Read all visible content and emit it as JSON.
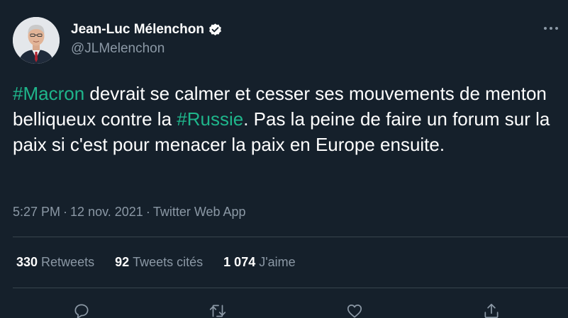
{
  "author": {
    "name": "Jean-Luc Mélenchon",
    "handle": "@JLMelenchon",
    "verified": true
  },
  "tweet": {
    "hashtag_1": "#Macron",
    "text_1": " devrait se calmer et cesser ses mouvements de menton belliqueux contre la ",
    "hashtag_2": "#Russie",
    "text_2": ". Pas la peine de faire un forum sur la paix si c'est pour menacer la paix en Europe ensuite."
  },
  "meta": {
    "time": "5:27 PM",
    "date": "12 nov. 2021",
    "source": "Twitter Web App",
    "separator": "·"
  },
  "stats": {
    "retweets_count": "330",
    "retweets_label": "Retweets",
    "quotes_count": "92",
    "quotes_label": "Tweets cités",
    "likes_count": "1 074",
    "likes_label": "J'aime"
  },
  "icons": {
    "more": "more-icon",
    "verified": "verified-badge-icon",
    "reply": "reply-icon",
    "retweet": "retweet-icon",
    "like": "like-icon",
    "share": "share-icon"
  },
  "colors": {
    "background": "#15202b",
    "hashtag": "#1fb58b",
    "secondary_text": "#8b98a5",
    "divider": "#38444d"
  }
}
